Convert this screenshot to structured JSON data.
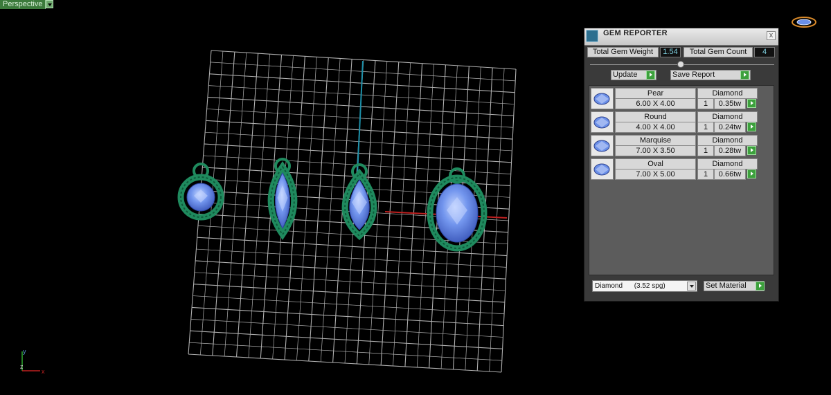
{
  "viewport": {
    "label": "Perspective",
    "axis": {
      "y": "y",
      "z": "z",
      "x": "x"
    }
  },
  "panel": {
    "title": "GEM REPORTER",
    "close": "x",
    "total_weight_label": "Total Gem Weight",
    "total_weight_value": "1.54",
    "total_count_label": "Total Gem Count",
    "total_count_value": "4",
    "update_label": "Update",
    "save_label": "Save Report",
    "gems": [
      {
        "shape": "Pear",
        "size": "6.00 X 4.00",
        "material": "Diamond",
        "qty": "1",
        "weight": "0.35tw"
      },
      {
        "shape": "Round",
        "size": "4.00 X 4.00",
        "material": "Diamond",
        "qty": "1",
        "weight": "0.24tw"
      },
      {
        "shape": "Marquise",
        "size": "7.00 X 3.50",
        "material": "Diamond",
        "qty": "1",
        "weight": "0.28tw"
      },
      {
        "shape": "Oval",
        "size": "7.00 X 5.00",
        "material": "Diamond",
        "qty": "1",
        "weight": "0.66tw"
      }
    ],
    "material_select": "Diamond      (3.52 spg)",
    "set_material_label": "Set Material"
  },
  "colors": {
    "gem": "#6a8fe8",
    "setting": "#1f8a5e",
    "grid": "#cfcfcf",
    "axis_y": "#1c8fa8",
    "axis_x": "#c02020"
  }
}
